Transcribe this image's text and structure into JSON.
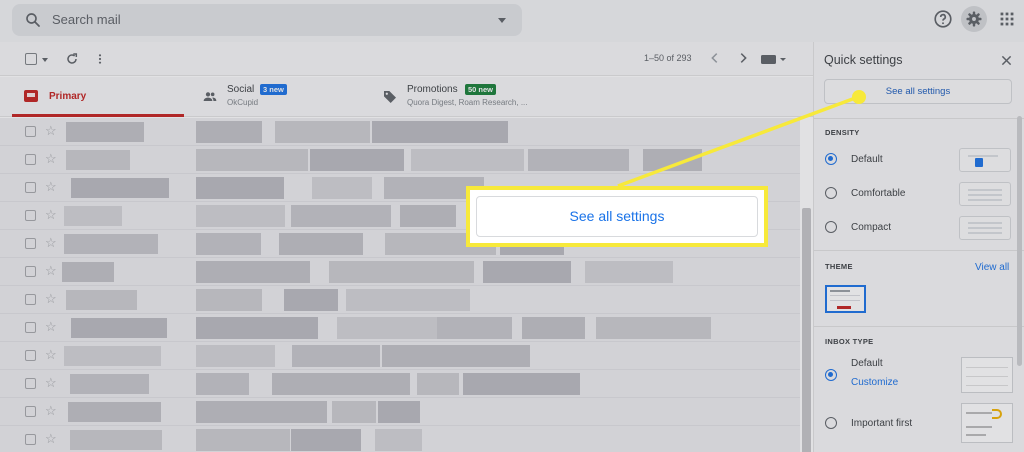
{
  "search": {
    "placeholder": "Search mail"
  },
  "toolbar": {
    "pager": "1–50 of 293"
  },
  "tabs": [
    {
      "label": "Primary",
      "active": true
    },
    {
      "label": "Social",
      "badge": "3 new",
      "badge_color": "#1a73e8",
      "subtitle": "OkCupid"
    },
    {
      "label": "Promotions",
      "badge": "50 new",
      "badge_color": "#188038",
      "subtitle": "Quora Digest, Roam Research, ..."
    }
  ],
  "accent_color": "#c5221f",
  "quick_settings": {
    "title": "Quick settings",
    "see_all_button": "See all settings",
    "density": {
      "heading": "DENSITY",
      "options": [
        "Default",
        "Comfortable",
        "Compact"
      ],
      "selected": "Default"
    },
    "theme": {
      "heading": "THEME",
      "view_all": "View all"
    },
    "inbox_type": {
      "heading": "INBOX TYPE",
      "options": [
        "Default",
        "Important first"
      ],
      "selected": "Default",
      "customize": "Customize"
    }
  },
  "callout": {
    "label": "See all settings",
    "highlight_color": "#f7e93a"
  },
  "icons": [
    "search-icon",
    "help-icon",
    "settings-gear-icon",
    "apps-grid-icon",
    "refresh-icon",
    "more-vert-icon",
    "chevron-left-icon",
    "chevron-right-icon",
    "close-icon",
    "people-icon",
    "tag-icon",
    "inbox-icon",
    "star-icon"
  ]
}
